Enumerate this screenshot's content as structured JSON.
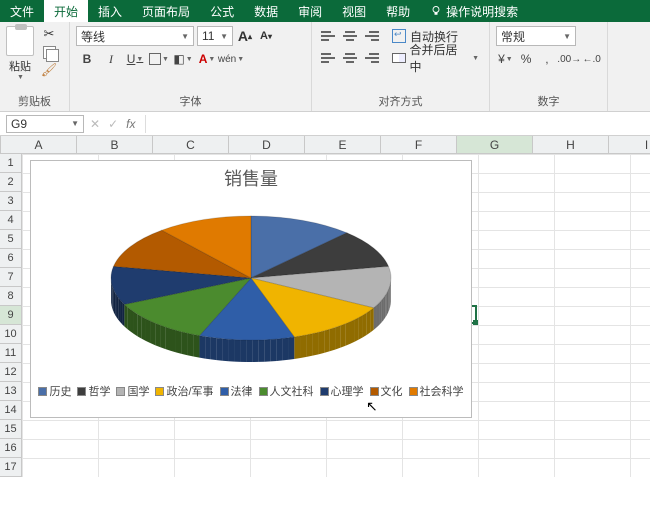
{
  "tabs": {
    "file": "文件",
    "home": "开始",
    "insert": "插入",
    "layout": "页面布局",
    "formulas": "公式",
    "data": "数据",
    "review": "审阅",
    "view": "视图",
    "help": "帮助",
    "tellme": "操作说明搜索"
  },
  "ribbon": {
    "clipboard": {
      "label": "剪贴板",
      "paste": "粘贴"
    },
    "font": {
      "label": "字体",
      "name": "等线",
      "size": "11",
      "inc": "A",
      "dec": "A",
      "bold": "B",
      "italic": "I",
      "under": "U",
      "ruby": "wén"
    },
    "alignment": {
      "label": "对齐方式",
      "wrap": "自动换行",
      "merge": "合并后居中"
    },
    "number": {
      "label": "数字",
      "format": "常规"
    }
  },
  "formula_bar": {
    "cell_ref": "G9",
    "fx": "fx"
  },
  "columns": [
    "A",
    "B",
    "C",
    "D",
    "E",
    "F",
    "G",
    "H",
    "I"
  ],
  "rows": [
    "1",
    "2",
    "3",
    "4",
    "5",
    "6",
    "7",
    "8",
    "9",
    "10",
    "11",
    "12",
    "13",
    "14",
    "15",
    "16",
    "17"
  ],
  "selected": {
    "col": "G",
    "row": "9"
  },
  "chart_data": {
    "type": "pie",
    "title": "销售量",
    "categories": [
      "历史",
      "哲学",
      "国学",
      "政治/军事",
      "法律",
      "人文社科",
      "心理学",
      "文化",
      "社会科学"
    ],
    "values": [
      12,
      10,
      11,
      12,
      11,
      12,
      10,
      11,
      11
    ],
    "colors": [
      "#4a6fa8",
      "#3d3d3d",
      "#b4b4b4",
      "#f0b400",
      "#2f5ea8",
      "#4b8b2e",
      "#1f3c6e",
      "#b35a00",
      "#e07a00"
    ],
    "legend_position": "bottom"
  }
}
